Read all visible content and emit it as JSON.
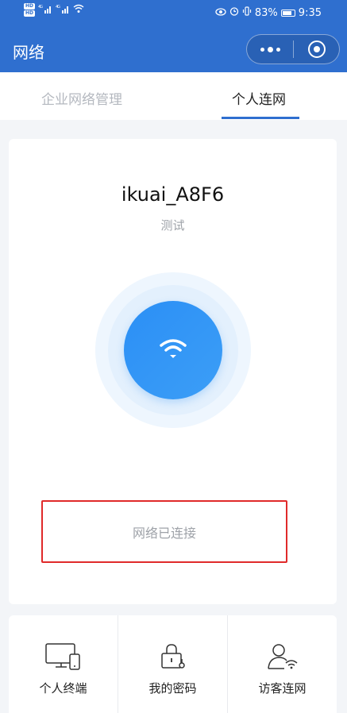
{
  "status_bar": {
    "network": "4G",
    "battery": "83%",
    "battery_level": 0.83,
    "time": "9:35"
  },
  "header": {
    "title": "网络"
  },
  "tabs": [
    {
      "label": "企业网络管理",
      "active": false
    },
    {
      "label": "个人连网",
      "active": true
    }
  ],
  "network": {
    "ssid": "ikuai_A8F6",
    "subtitle": "测试",
    "status": "网络已连接"
  },
  "bottom_menu": [
    {
      "label": "个人终端",
      "icon": "devices-icon"
    },
    {
      "label": "我的密码",
      "icon": "lock-icon"
    },
    {
      "label": "访客连网",
      "icon": "guest-wifi-icon"
    }
  ],
  "colors": {
    "primary": "#2f6fcf",
    "accent": "#2b8ff5",
    "highlight_border": "#e02a2a"
  }
}
